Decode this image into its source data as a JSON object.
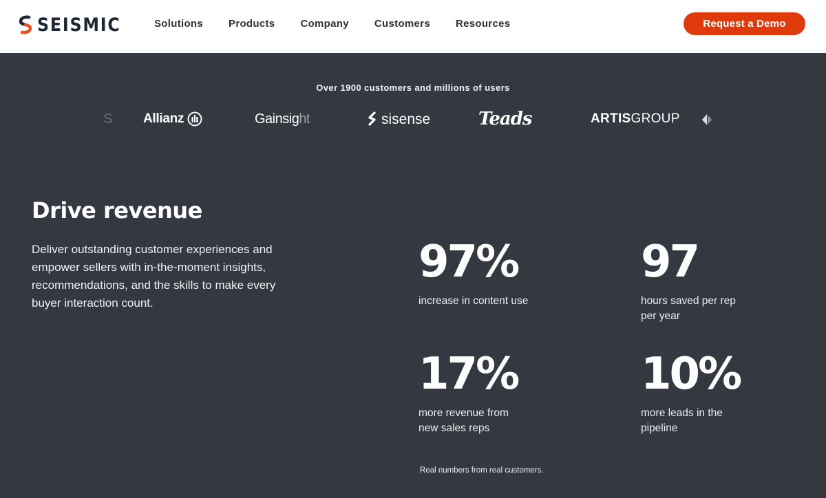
{
  "header": {
    "logo_text": "SEISMIC",
    "nav": [
      "Solutions",
      "Products",
      "Company",
      "Customers",
      "Resources"
    ],
    "cta_label": "Request a Demo"
  },
  "customers": {
    "heading": "Over 1900 customers and millions of users",
    "logos": {
      "partial": "S",
      "allianz": "Allianz",
      "gainsight_main": "Gainsig",
      "gainsight_fade": "ht",
      "sisense": "sisense",
      "teads": "Teads",
      "artis_bold": "ARTIS",
      "artis_light": "GROUP"
    }
  },
  "section": {
    "title": "Drive revenue",
    "description": "Deliver outstanding customer experiences and empower sellers with in-the-moment insights, recommendations, and the skills to make every buyer interaction count."
  },
  "stats": [
    {
      "value": "97%",
      "label": "increase in content use"
    },
    {
      "value": "97",
      "label": "hours saved per rep per year"
    },
    {
      "value": "17%",
      "label": "more revenue from new sales reps"
    },
    {
      "value": "10%",
      "label": "more leads in the pipeline"
    }
  ],
  "footnote": "Real numbers from real customers.",
  "colors": {
    "accent": "#de3a0c",
    "background": "#343941",
    "header_bg": "#ffffff"
  }
}
